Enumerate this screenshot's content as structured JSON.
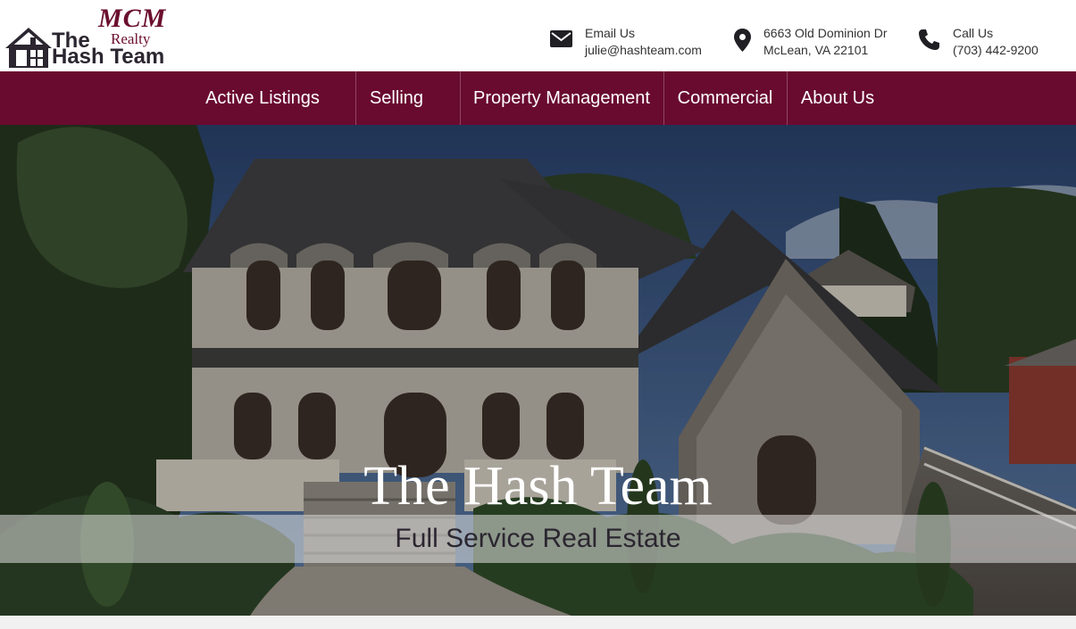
{
  "logo": {
    "mcm": "MCM",
    "realty": "Realty",
    "the": "The",
    "hash_team": "Hash Team"
  },
  "contacts": [
    {
      "icon": "envelope-icon",
      "title": "Email Us",
      "detail": "julie@hashteam.com"
    },
    {
      "icon": "map-pin-icon",
      "title": "6663 Old Dominion Dr",
      "detail": "McLean, VA 22101"
    },
    {
      "icon": "phone-icon",
      "title": "Call Us",
      "detail": "(703) 442-9200"
    }
  ],
  "nav": {
    "items": [
      "Active Listings",
      "Selling",
      "Property Management",
      "Commercial",
      "About Us"
    ]
  },
  "hero": {
    "title": "The Hash Team",
    "subtitle": "Full Service Real Estate"
  },
  "colors": {
    "brand": "#690a2f",
    "logo_dark": "#2b2630"
  }
}
